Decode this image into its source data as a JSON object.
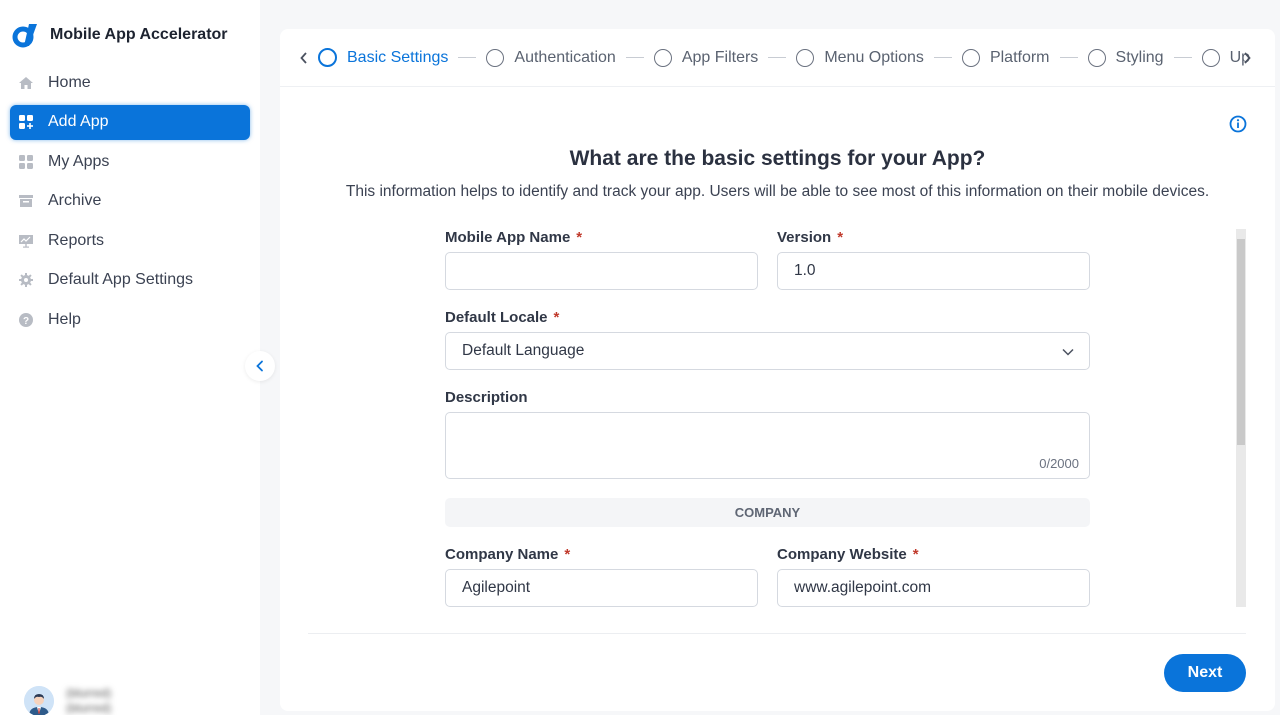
{
  "app": {
    "title": "Mobile App Accelerator",
    "brand_color": "#0a74da"
  },
  "sidebar": {
    "items": [
      {
        "label": "Home",
        "icon": "home-icon",
        "active": false
      },
      {
        "label": "Add App",
        "icon": "add-app-icon",
        "active": true
      },
      {
        "label": "My Apps",
        "icon": "grid-icon",
        "active": false
      },
      {
        "label": "Archive",
        "icon": "archive-icon",
        "active": false
      },
      {
        "label": "Reports",
        "icon": "reports-icon",
        "active": false
      },
      {
        "label": "Default App Settings",
        "icon": "gear-icon",
        "active": false
      },
      {
        "label": "Help",
        "icon": "help-icon",
        "active": false
      }
    ],
    "collapse_icon": "chevron-left-icon"
  },
  "user": {
    "name": "(blurred)",
    "role": "(blurred)"
  },
  "stepper": {
    "steps": [
      {
        "label": "Basic Settings",
        "active": true
      },
      {
        "label": "Authentication",
        "active": false
      },
      {
        "label": "App Filters",
        "active": false
      },
      {
        "label": "Menu Options",
        "active": false
      },
      {
        "label": "Platform",
        "active": false
      },
      {
        "label": "Styling",
        "active": false
      },
      {
        "label": "Up",
        "active": false
      }
    ]
  },
  "main": {
    "title": "What are the basic settings for your App?",
    "subtitle": "This information helps to identify and track your app. Users will be able to see most of this information on their mobile devices.",
    "info_icon": "info-icon"
  },
  "form": {
    "required_mark": "*",
    "mobile_app_name": {
      "label": "Mobile App Name",
      "value": "",
      "required": true
    },
    "version": {
      "label": "Version",
      "value": "1.0",
      "required": true
    },
    "default_locale": {
      "label": "Default Locale",
      "value": "Default Language",
      "required": true
    },
    "description": {
      "label": "Description",
      "value": "",
      "counter": "0/2000"
    },
    "company_section": "COMPANY",
    "company_name": {
      "label": "Company Name",
      "value": "Agilepoint",
      "required": true
    },
    "company_website": {
      "label": "Company Website",
      "value": "www.agilepoint.com",
      "required": true
    }
  },
  "footer": {
    "next_label": "Next"
  }
}
